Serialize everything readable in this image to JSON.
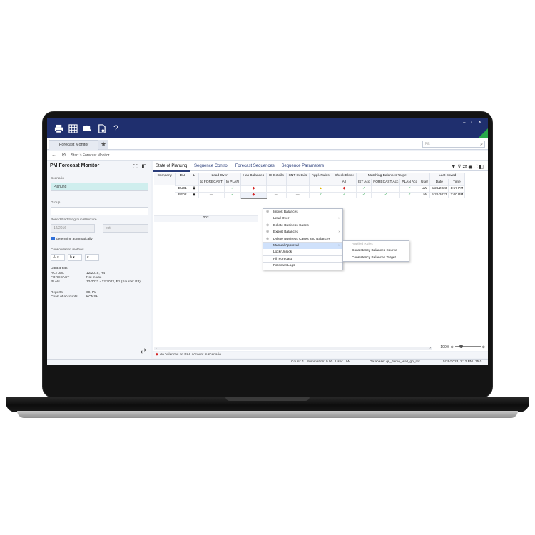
{
  "toolbar": {
    "icons": [
      "print-icon",
      "table-icon",
      "export-icon",
      "document-icon",
      "help-icon"
    ],
    "help_glyph": "?"
  },
  "tabs": {
    "active": "Forecast Monitor"
  },
  "search": {
    "placeholder": "Filt"
  },
  "breadcrumb": {
    "path": "Start > Forecast Monitor"
  },
  "left_panel": {
    "title": "PM Forecast Monitor",
    "scenario_label": "Scenario",
    "scenario_value": "Planung",
    "group_label": "Group",
    "group_value": "",
    "period_label": "Period/Part for group structure",
    "period_value": "12/2016",
    "period_second": "est",
    "auto_label": "determine automatically",
    "consolidation_label": "Consolidation method",
    "drop1": "-/-",
    "drop2": "b",
    "drop3": "",
    "data_areas_label": "Data areas",
    "data_areas": [
      {
        "key": "ACTUAL",
        "value": "12/2019, H4"
      },
      {
        "key": "FORECAST",
        "value": "Not in use"
      },
      {
        "key": "PLAN",
        "value": "12/2021 - 12/2023, P1 (Source: P3)"
      }
    ],
    "reports": [
      {
        "key": "Reports",
        "value": "69, PL"
      },
      {
        "key": "Chart of accounts",
        "value": "KONSH"
      }
    ]
  },
  "subtabs": [
    "State of Planung",
    "Sequence Control",
    "Forecast Sequences",
    "Sequence Parameters"
  ],
  "grid": {
    "header1": [
      "Company",
      "BU",
      "L",
      "Lead Over",
      "Has Balances",
      "IC Details",
      "CNT Details",
      "Appl. Rules",
      "Check Block",
      "Matching Balances Target",
      "Last Saved"
    ],
    "header2": [
      "",
      "",
      "",
      "to FORECAST",
      "to PLAN",
      "",
      "",
      "",
      "",
      "All",
      "IST Acc",
      "FORECAST Acc",
      "PLAN Acc",
      "User",
      "Date",
      "Time"
    ],
    "rows": [
      {
        "company": "001",
        "bu": "BU01",
        "user": "UW",
        "date": "5/26/2023",
        "time": "1:57 PM"
      },
      {
        "company": "002",
        "bu": "BF02",
        "user": "UW",
        "date": "5/26/2023",
        "time": "2:00 PM"
      }
    ]
  },
  "context_menu": [
    {
      "label": "Import Balances",
      "icon": "import-icon",
      "arrow": false
    },
    {
      "label": "Lead Over",
      "icon": "",
      "arrow": true
    },
    {
      "label": "Delete Business Cases",
      "icon": "delete-icon",
      "arrow": false
    },
    {
      "label": "Export Balances",
      "icon": "export-icon",
      "arrow": true
    },
    {
      "label": "Delete Business Cases and Balances",
      "icon": "delete-icon",
      "arrow": false
    },
    {
      "label": "Manual Approval",
      "icon": "",
      "arrow": true
    },
    {
      "label": "Lock/Unlock",
      "icon": "",
      "arrow": false
    },
    {
      "label": "Fill Forecast",
      "icon": "",
      "arrow": false
    },
    {
      "label": "Forecast Logs",
      "icon": "",
      "arrow": false
    }
  ],
  "submenu": [
    "Applied Rules",
    "Consistency Balances Source",
    "Consistency Balances Target"
  ],
  "zoom": "100%",
  "message": "No balances on P&L account in scenario",
  "status": {
    "count": "Count: 1",
    "summation": "Summation: 0.00",
    "user": "User: UW",
    "database": "Database: qs_demo_wall_gb_mk",
    "datetime": "5/26/2023, 2:12 PM",
    "extra": "75 0"
  }
}
